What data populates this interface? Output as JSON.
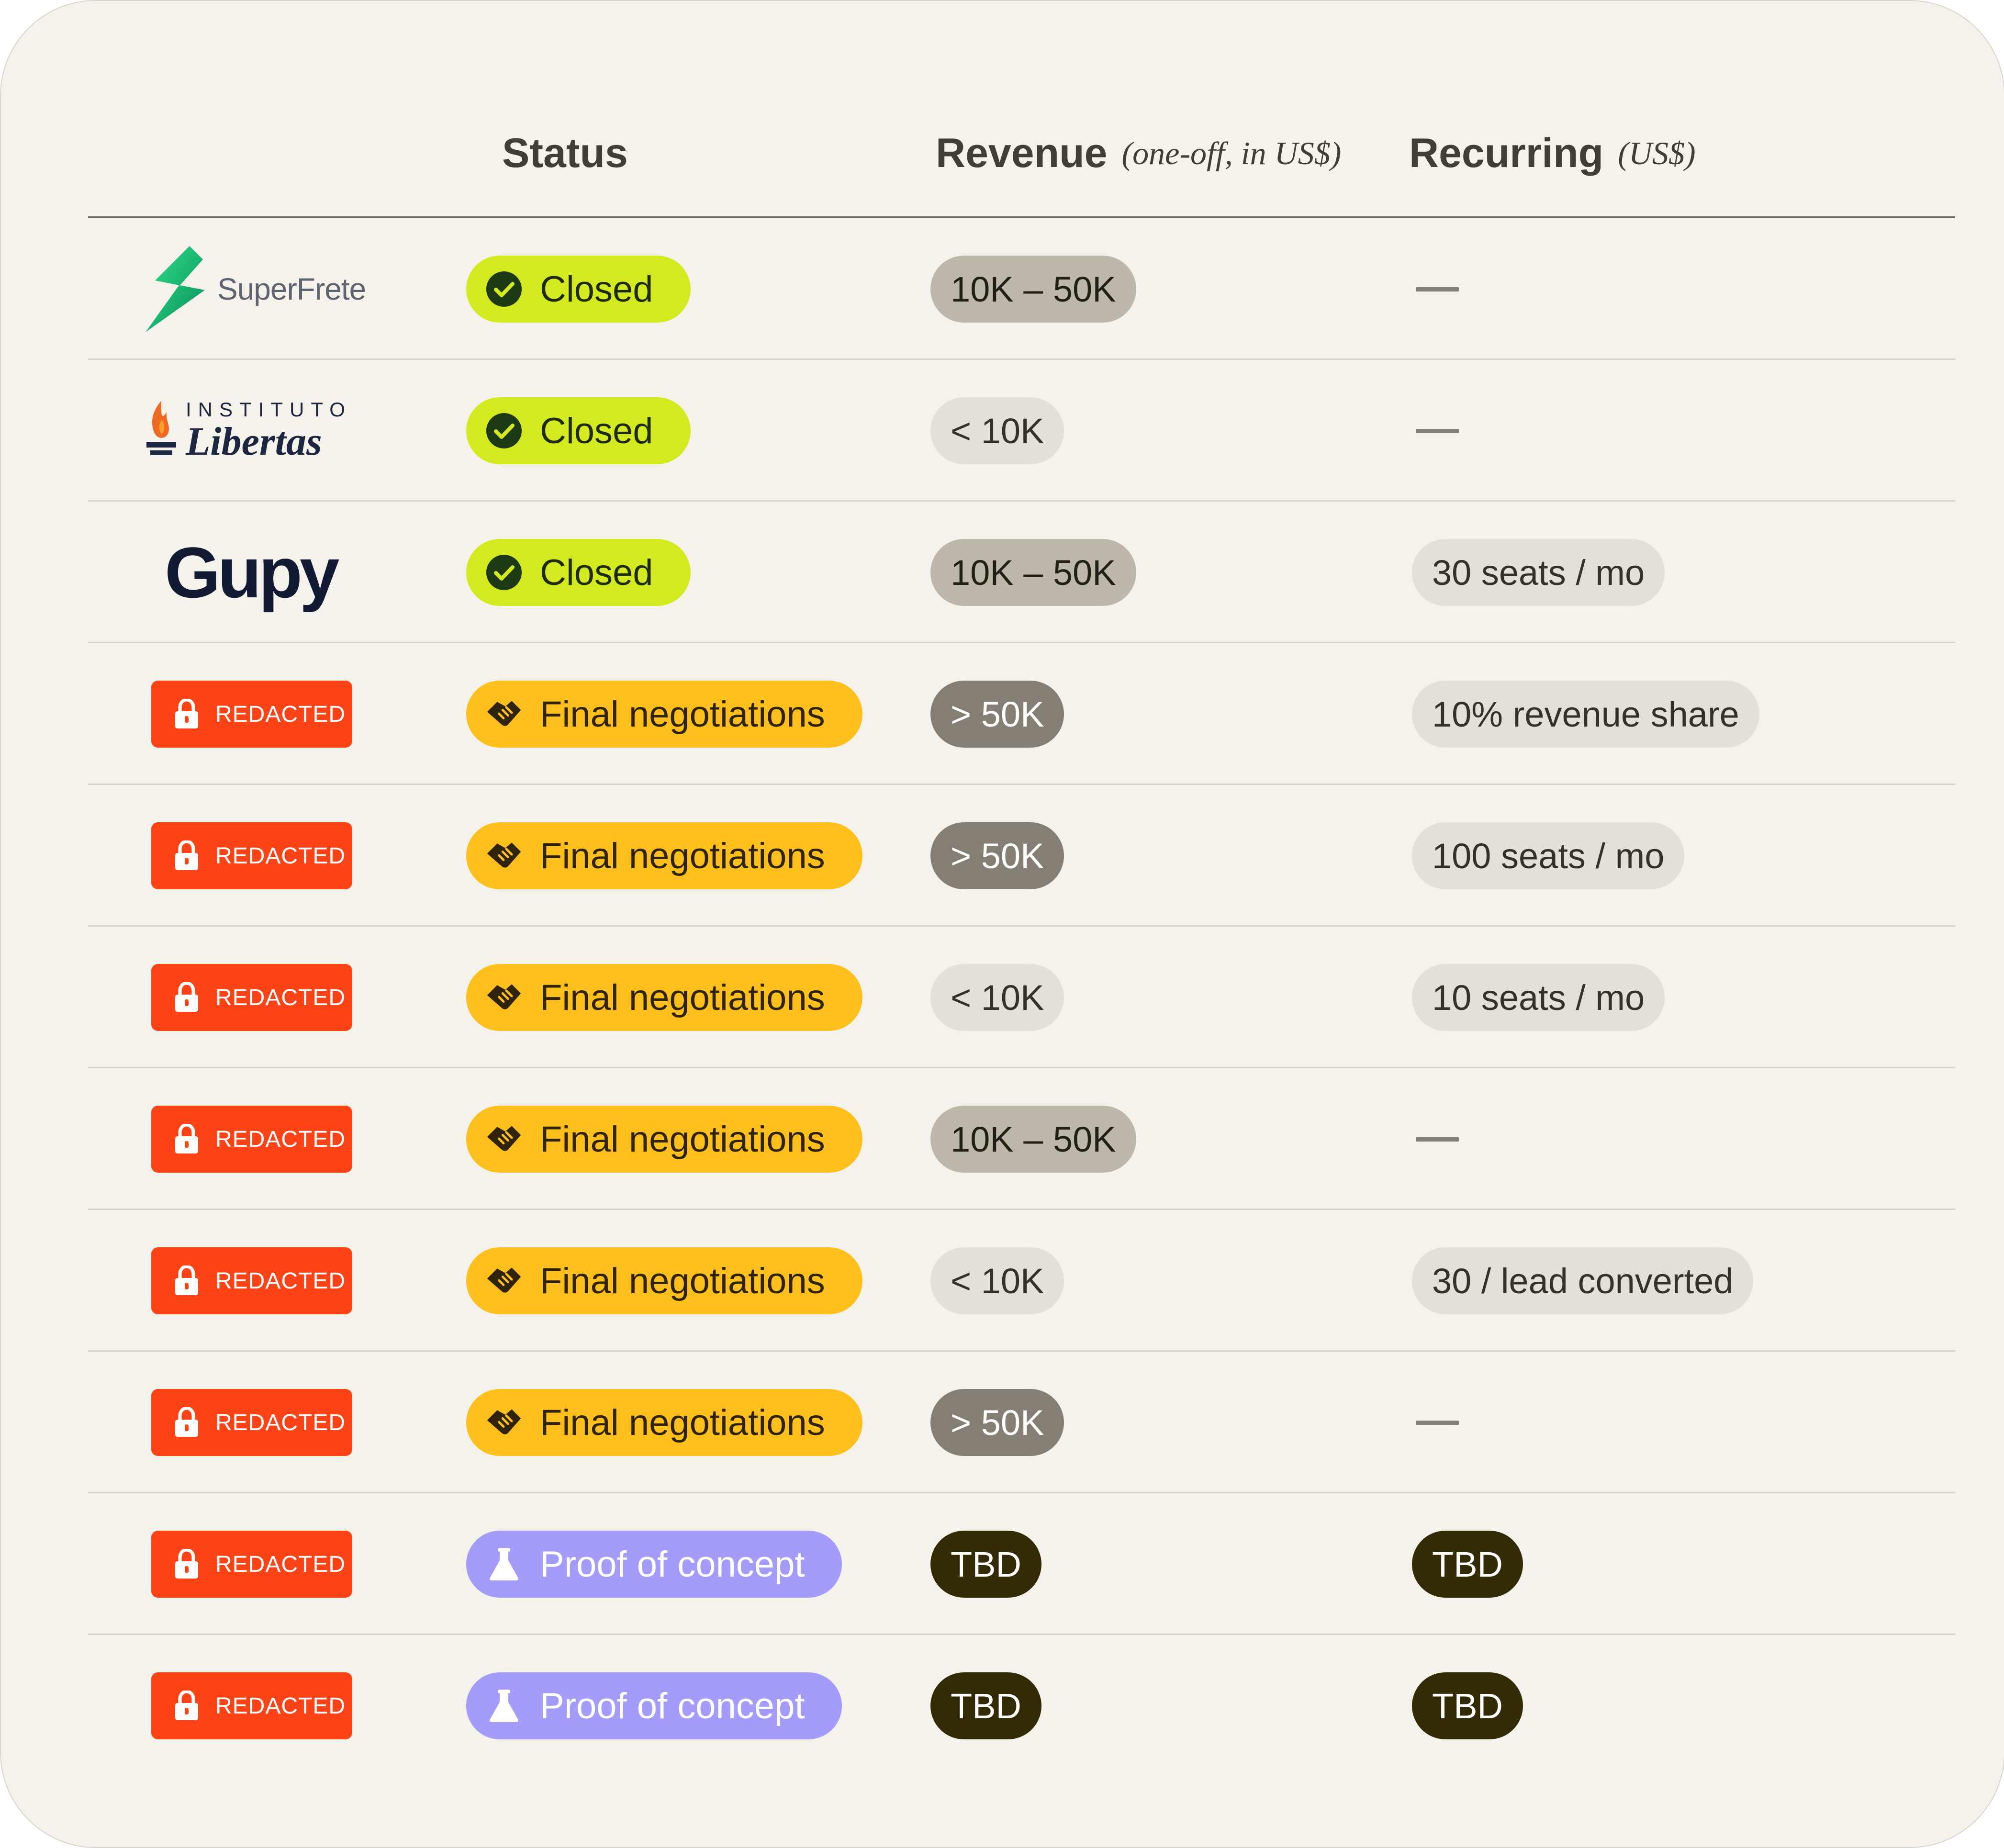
{
  "header": {
    "status": "Status",
    "revenue": "Revenue",
    "revenue_note": "(one-off, in US$)",
    "recurring": "Recurring",
    "recurring_note": "(US$)"
  },
  "logos": {
    "superfrete": "SuperFrete",
    "libertas_top": "INSTITUTO",
    "libertas_main": "Libertas",
    "gupy": "Gupy"
  },
  "redacted_label": "REDACTED",
  "rows": [
    {
      "client": "superfrete",
      "status": "Closed",
      "status_kind": "closed",
      "revenue": "10K – 50K",
      "revenue_kind": "mid",
      "recurring": null
    },
    {
      "client": "libertas",
      "status": "Closed",
      "status_kind": "closed",
      "revenue": "< 10K",
      "revenue_kind": "low",
      "recurring": null
    },
    {
      "client": "gupy",
      "status": "Closed",
      "status_kind": "closed",
      "revenue": "10K – 50K",
      "revenue_kind": "mid",
      "recurring": "30 seats / mo"
    },
    {
      "client": "redacted",
      "status": "Final negotiations",
      "status_kind": "final",
      "revenue": "> 50K",
      "revenue_kind": "high",
      "recurring": "10% revenue share"
    },
    {
      "client": "redacted",
      "status": "Final negotiations",
      "status_kind": "final",
      "revenue": "> 50K",
      "revenue_kind": "high",
      "recurring": "100 seats / mo"
    },
    {
      "client": "redacted",
      "status": "Final negotiations",
      "status_kind": "final",
      "revenue": "< 10K",
      "revenue_kind": "low",
      "recurring": "10 seats / mo"
    },
    {
      "client": "redacted",
      "status": "Final negotiations",
      "status_kind": "final",
      "revenue": "10K – 50K",
      "revenue_kind": "mid",
      "recurring": null
    },
    {
      "client": "redacted",
      "status": "Final negotiations",
      "status_kind": "final",
      "revenue": "< 10K",
      "revenue_kind": "low",
      "recurring": "30 / lead converted"
    },
    {
      "client": "redacted",
      "status": "Final negotiations",
      "status_kind": "final",
      "revenue": "> 50K",
      "revenue_kind": "high",
      "recurring": null
    },
    {
      "client": "redacted",
      "status": "Proof of concept",
      "status_kind": "poc",
      "revenue": "TBD",
      "revenue_kind": "tbd",
      "recurring": "TBD",
      "recurring_kind": "tbd"
    },
    {
      "client": "redacted",
      "status": "Proof of concept",
      "status_kind": "poc",
      "revenue": "TBD",
      "revenue_kind": "tbd",
      "recurring": "TBD",
      "recurring_kind": "tbd"
    }
  ],
  "icons": {
    "closed": "check-circle-icon",
    "final": "handshake-icon",
    "poc": "flask-icon",
    "redacted": "lock-icon",
    "empty": "em-dash"
  },
  "colors": {
    "background": "#f5f2ec",
    "closed": "#d4ea20",
    "final_negotiations": "#ffc01d",
    "proof_of_concept": "#a39cfb",
    "redacted": "#fe4416",
    "revenue_high": "#857e74",
    "revenue_mid": "#bdb8ab",
    "revenue_low": "#e4e0d8",
    "tbd": "#332a06"
  }
}
